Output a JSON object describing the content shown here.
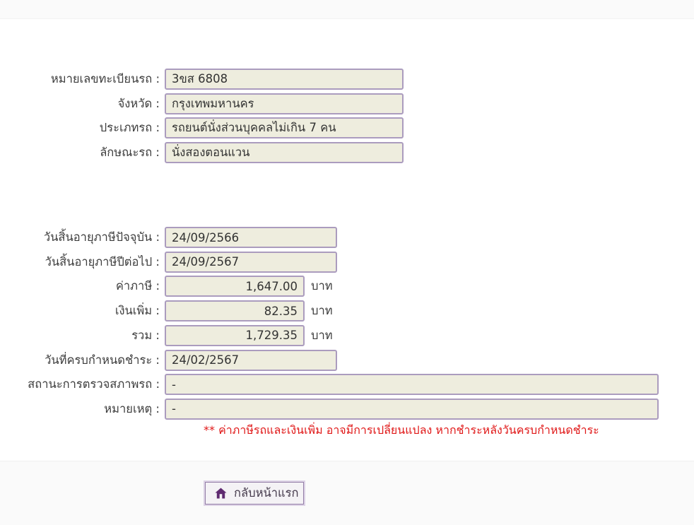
{
  "colors": {
    "band_bg": "#fafafa",
    "content_bg": "#ffffff",
    "field_bg": "#eeedde",
    "field_border": "#ab9cbe",
    "label_text": "#3d3d3d",
    "value_text": "#333333",
    "note_red": "#e01717",
    "button_bg": "#f4f2f5",
    "button_border_outer": "#ddd3e6",
    "button_border_inner": "#937ea7",
    "home_icon_purple": "#5f2a70"
  },
  "vehicle_section": {
    "registration_number": {
      "label": "หมายเลขทะเบียนรถ :",
      "value": "3ขส 6808"
    },
    "province": {
      "label": "จังหวัด :",
      "value": "กรุงเทพมหานคร"
    },
    "vehicle_type": {
      "label": "ประเภทรถ :",
      "value": "รถยนต์นั่งส่วนบุคคลไม่เกิน 7 คน"
    },
    "body_style": {
      "label": "ลักษณะรถ :",
      "value": "นั่งสองตอนแวน"
    }
  },
  "tax_section": {
    "tax_expiry_current": {
      "label": "วันสิ้นอายุภาษีปัจจุบัน :",
      "value": "24/09/2566"
    },
    "tax_expiry_next": {
      "label": "วันสิ้นอายุภาษีปีต่อไป :",
      "value": "24/09/2567"
    },
    "tax_amount": {
      "label": "ค่าภาษี :",
      "value": "1,647.00",
      "unit": "บาท"
    },
    "surcharge": {
      "label": "เงินเพิ่ม :",
      "value": "82.35",
      "unit": "บาท"
    },
    "total": {
      "label": "รวม :",
      "value": "1,729.35",
      "unit": "บาท"
    },
    "payment_due_date": {
      "label": "วันที่ครบกำหนดชำระ :",
      "value": "24/02/2567"
    },
    "inspection_status": {
      "label": "สถานะการตรวจสภาพรถ :",
      "value": "-"
    },
    "remark": {
      "label": "หมายเหตุ :",
      "value": "-"
    }
  },
  "note": "** ค่าภาษีรถและเงินเพิ่ม อาจมีการเปลี่ยนแปลง หากชำระหลังวันครบกำหนดชำระ",
  "footer": {
    "home_button_label": "กลับหน้าแรก",
    "home_icon": "home-icon"
  }
}
